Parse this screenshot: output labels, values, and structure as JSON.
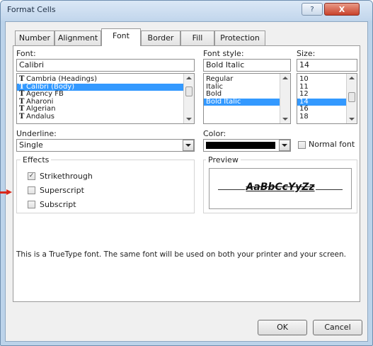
{
  "window": {
    "title": "Format Cells",
    "help_label": "?",
    "close_label": "X"
  },
  "tabs": [
    {
      "label": "Number"
    },
    {
      "label": "Alignment"
    },
    {
      "label": "Font"
    },
    {
      "label": "Border"
    },
    {
      "label": "Fill"
    },
    {
      "label": "Protection"
    }
  ],
  "active_tab": "Font",
  "font": {
    "label": "Font:",
    "value": "Calibri",
    "items": [
      {
        "label": "Cambria (Headings)",
        "selected": false
      },
      {
        "label": "Calibri (Body)",
        "selected": true
      },
      {
        "label": "Agency FB",
        "selected": false
      },
      {
        "label": "Aharoni",
        "selected": false
      },
      {
        "label": "Algerian",
        "selected": false
      },
      {
        "label": "Andalus",
        "selected": false
      }
    ],
    "truetype_icon": "truetype-icon"
  },
  "font_style": {
    "label": "Font style:",
    "value": "Bold Italic",
    "items": [
      {
        "label": "Regular",
        "selected": false
      },
      {
        "label": "Italic",
        "selected": false
      },
      {
        "label": "Bold",
        "selected": false
      },
      {
        "label": "Bold Italic",
        "selected": true
      }
    ]
  },
  "size": {
    "label": "Size:",
    "value": "14",
    "items": [
      {
        "label": "10",
        "selected": false
      },
      {
        "label": "11",
        "selected": false
      },
      {
        "label": "12",
        "selected": false
      },
      {
        "label": "14",
        "selected": true
      },
      {
        "label": "16",
        "selected": false
      },
      {
        "label": "18",
        "selected": false
      }
    ]
  },
  "underline": {
    "label": "Underline:",
    "value": "Single"
  },
  "color": {
    "label": "Color:",
    "swatch": "#000000",
    "normal_font_label": "Normal font",
    "normal_font_checked": false
  },
  "effects": {
    "label": "Effects",
    "strikethrough": {
      "label": "Strikethrough",
      "checked": true
    },
    "superscript": {
      "label": "Superscript",
      "checked": false
    },
    "subscript": {
      "label": "Subscript",
      "checked": false
    }
  },
  "preview": {
    "label": "Preview",
    "sample": "AaBbCcYyZz"
  },
  "description": "This is a TrueType font.  The same font will be used on both your printer and your screen.",
  "buttons": {
    "ok": "OK",
    "cancel": "Cancel"
  },
  "colors": {
    "selection": "#3399ff",
    "annotation_arrow": "#d9281c",
    "title_bar": "#c2d6ec",
    "close_button": "#c9432c"
  }
}
